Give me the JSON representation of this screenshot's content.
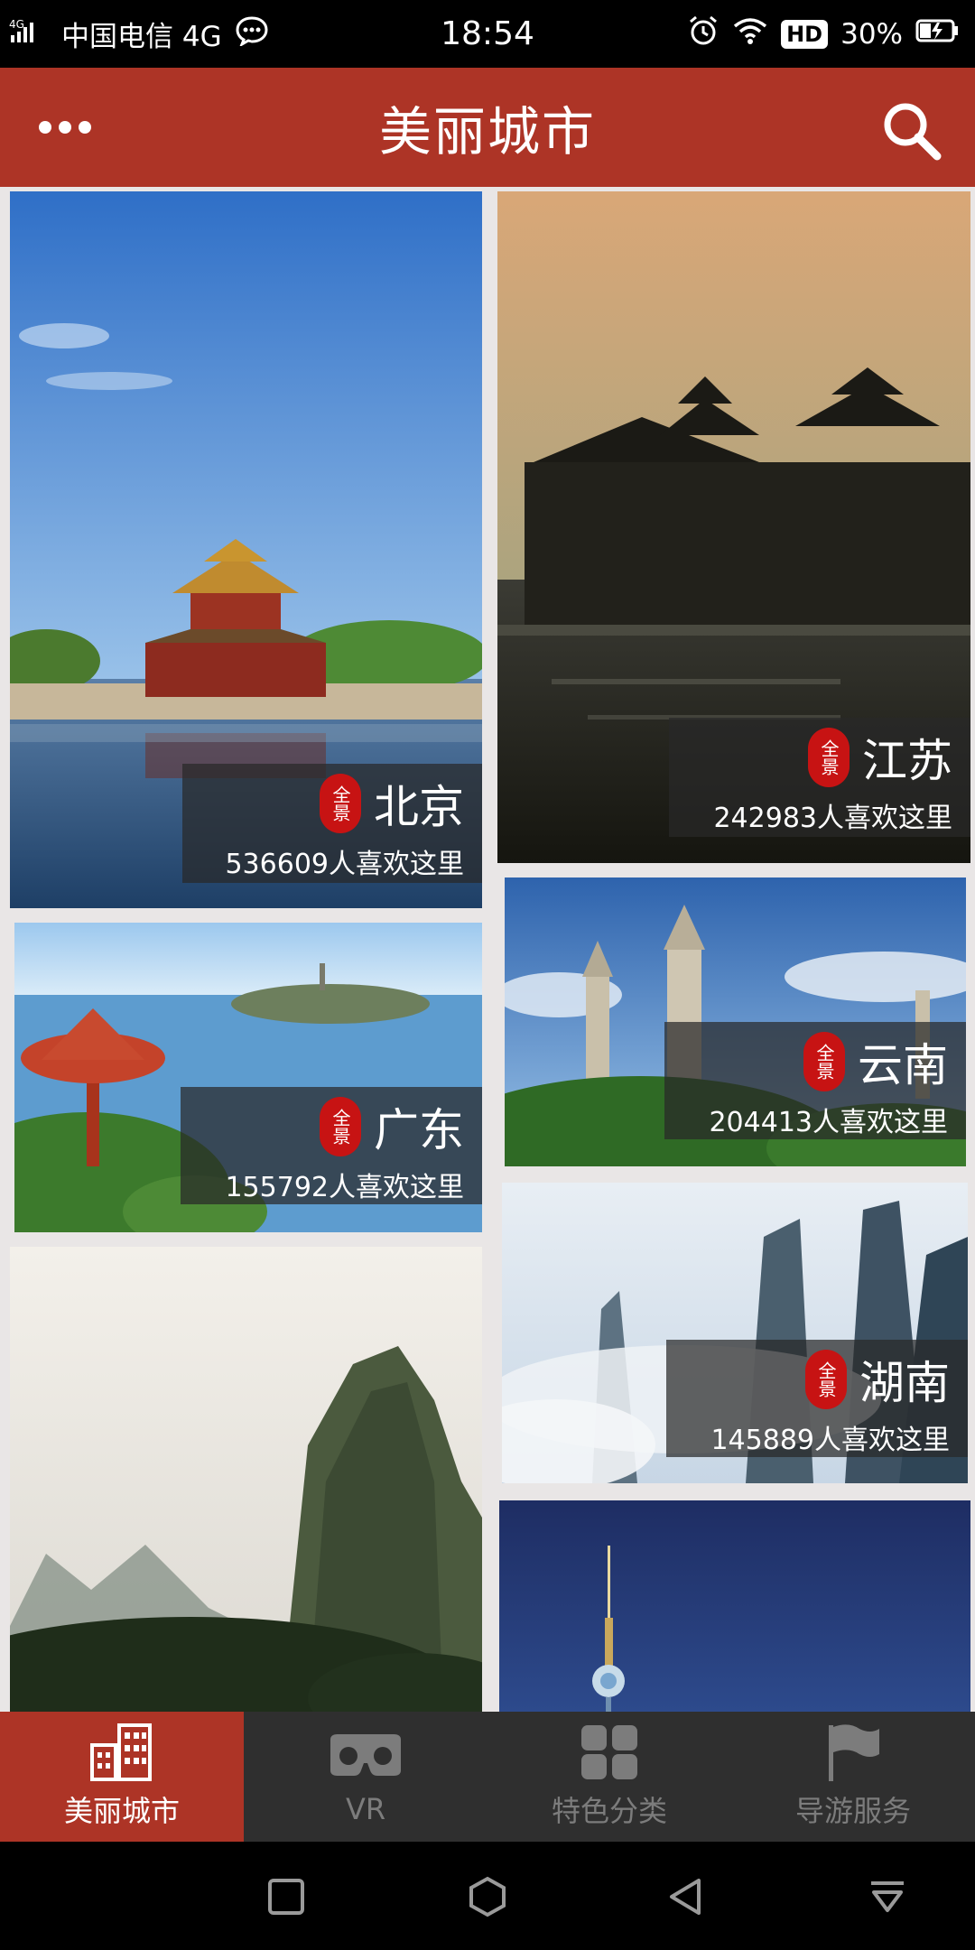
{
  "status_bar": {
    "network": "4G",
    "carrier": "中国电信 4G",
    "time": "18:54",
    "hd": "HD",
    "battery": "30%"
  },
  "header": {
    "title": "美丽城市"
  },
  "cities": [
    {
      "name": "北京",
      "likes": "536609人喜欢这里"
    },
    {
      "name": "江苏",
      "likes": "242983人喜欢这里"
    },
    {
      "name": "云南",
      "likes": "204413人喜欢这里"
    },
    {
      "name": "广东",
      "likes": "155792人喜欢这里"
    },
    {
      "name": "湖南",
      "likes": "145889人喜欢这里"
    }
  ],
  "seal_text": "全景",
  "tabs": [
    {
      "label": "美丽城市",
      "icon": "city-buildings-icon",
      "active": true
    },
    {
      "label": "VR",
      "icon": "vr-headset-icon",
      "active": false
    },
    {
      "label": "特色分类",
      "icon": "grid-icon",
      "active": false
    },
    {
      "label": "导游服务",
      "icon": "flag-icon",
      "active": false
    }
  ],
  "colors": {
    "accent": "#ad3426",
    "tab_bar": "#2f2f2f",
    "background": "#e9e6e6"
  }
}
